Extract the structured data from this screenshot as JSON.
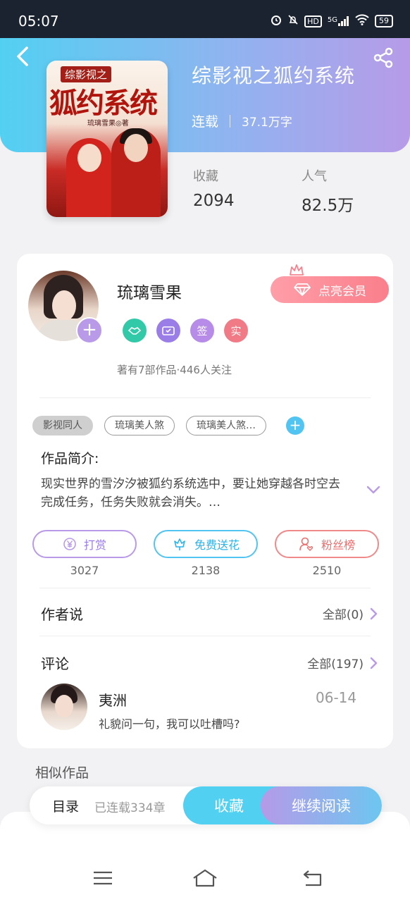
{
  "status_bar": {
    "time": "05:07",
    "battery": "59",
    "network": "5G",
    "hd": "HD"
  },
  "book": {
    "title": "综影视之狐约系统",
    "status": "连载",
    "word_count": "37.1万字",
    "cover_subtitle": "综影视之",
    "cover_title": "狐约系统",
    "cover_author": "琉璃雪果◎著"
  },
  "stats": [
    {
      "label": "收藏",
      "value": "2094"
    },
    {
      "label": "人气",
      "value": "82.5万"
    }
  ],
  "author": {
    "name": "琉璃雪果",
    "vip_label": "点亮会员",
    "badges": [
      "",
      "",
      "签",
      "实"
    ],
    "summary": "著有7部作品·446人关注"
  },
  "tags": [
    "影视同人",
    "琉璃美人煞",
    "琉璃美人煞…"
  ],
  "intro": {
    "title": "作品简介:",
    "text": "现实世界的雪汐汐被狐约系统选中，要让她穿越各时空去完成任务，任务失败就会消失。…"
  },
  "actions": [
    {
      "label": "打赏",
      "count": "3027",
      "icon": "yen-icon"
    },
    {
      "label": "免费送花",
      "count": "2138",
      "icon": "flower-icon"
    },
    {
      "label": "粉丝榜",
      "count": "2510",
      "icon": "fans-icon"
    }
  ],
  "author_says": {
    "title": "作者说",
    "link": "全部(0)"
  },
  "comments": {
    "title": "评论",
    "link": "全部(197)",
    "items": [
      {
        "name": "夷洲",
        "date": "06-14",
        "text": "礼貌问一句，我可以吐槽吗?"
      }
    ]
  },
  "similar": {
    "title": "相似作品"
  },
  "bottom_bar": {
    "toc": "目录",
    "chapters": "已连载334章",
    "favorite": "收藏",
    "continue": "继续阅读"
  },
  "colors": {
    "accent_blue": "#52d0f2",
    "accent_purple": "#b99ae9",
    "accent_red": "#f08a8a"
  }
}
